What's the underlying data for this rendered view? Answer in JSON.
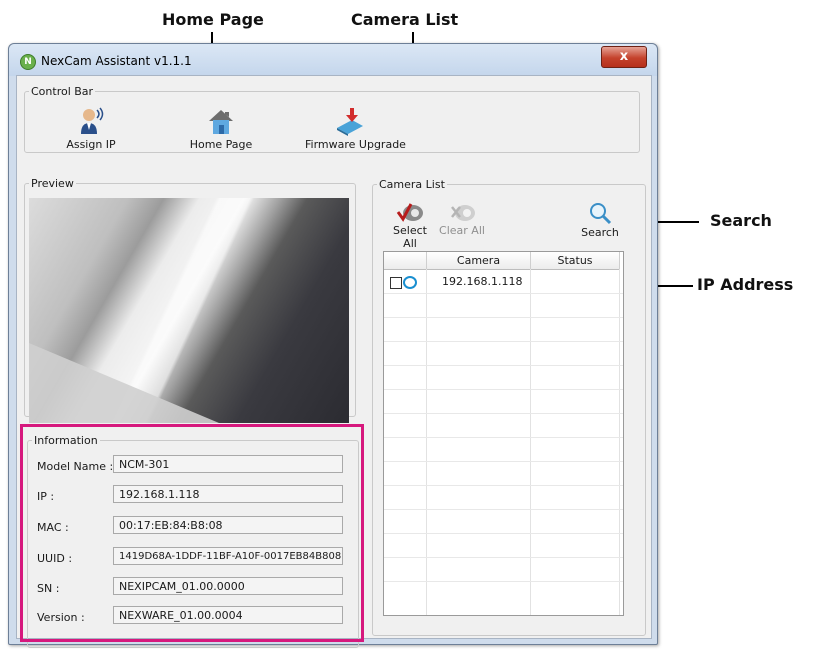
{
  "callouts": {
    "home_page": "Home Page",
    "camera_list": "Camera List",
    "search": "Search",
    "ip_address": "IP Address"
  },
  "window": {
    "title": "NexCam Assistant v1.1.1",
    "close_label": "x"
  },
  "control_bar": {
    "legend": "Control Bar",
    "buttons": [
      {
        "label": "Assign IP",
        "icon": "assign-ip-icon"
      },
      {
        "label": "Home Page",
        "icon": "home-icon"
      },
      {
        "label": "Firmware Upgrade",
        "icon": "firmware-upgrade-icon"
      }
    ]
  },
  "preview": {
    "legend": "Preview"
  },
  "information": {
    "legend": "Information",
    "rows": [
      {
        "label": "Model Name :",
        "value": "NCM-301"
      },
      {
        "label": "IP :",
        "value": "192.168.1.118"
      },
      {
        "label": "MAC :",
        "value": "00:17:EB:84:B8:08"
      },
      {
        "label": "UUID :",
        "value": "1419D68A-1DDF-11BF-A10F-0017EB84B808"
      },
      {
        "label": "SN :",
        "value": "NEXIPCAM_01.00.0000"
      },
      {
        "label": "Version :",
        "value": "NEXWARE_01.00.0004"
      }
    ]
  },
  "camera_list": {
    "legend": "Camera List",
    "select_all": "Select All",
    "clear_all": "Clear All",
    "search": "Search",
    "columns": [
      "Camera",
      "Status"
    ],
    "rows": [
      {
        "camera": "192.168.1.118",
        "status": "",
        "checked": false
      }
    ]
  },
  "colors": {
    "highlight_frame": "#d6187d",
    "close_button": "#c4422c",
    "camera_icon": "#1a8fd0"
  }
}
